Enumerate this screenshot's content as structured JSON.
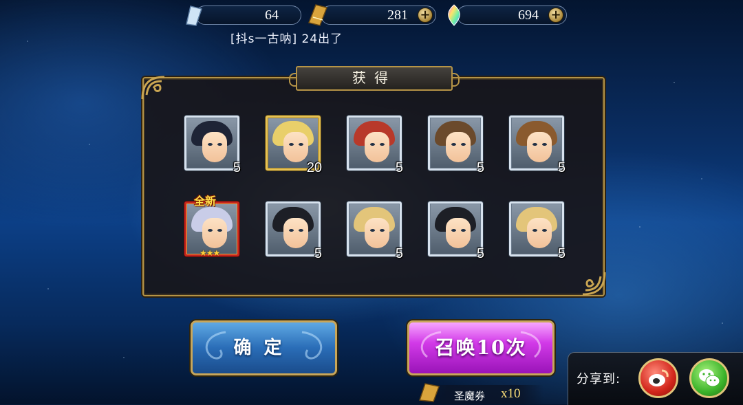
{
  "currencies": [
    {
      "name": "crystal",
      "value": "64",
      "has_plus": false,
      "icon": "crystal-icon"
    },
    {
      "name": "ticket",
      "value": "281",
      "has_plus": true,
      "icon": "gold-ticket-icon"
    },
    {
      "name": "gem",
      "value": "694",
      "has_plus": true,
      "icon": "rainbow-gem-icon"
    }
  ],
  "plus_symbol": "+",
  "ticker": "[抖s一古呐] 24出了",
  "panel": {
    "title": "获得"
  },
  "cards": [
    {
      "count": "5",
      "frame": "silver",
      "hair": "#1e2436",
      "new": false
    },
    {
      "count": "20",
      "frame": "gold",
      "hair": "#e9cf6a",
      "new": false
    },
    {
      "count": "5",
      "frame": "silver",
      "hair": "#b8392a",
      "new": false
    },
    {
      "count": "5",
      "frame": "silver",
      "hair": "#6b4a2c",
      "new": false
    },
    {
      "count": "5",
      "frame": "silver",
      "hair": "#8a5a2e",
      "new": false
    },
    {
      "count": "",
      "frame": "red",
      "hair": "#c9cde8",
      "new": true,
      "new_label": "全新",
      "stars": "★★★"
    },
    {
      "count": "5",
      "frame": "silver",
      "hair": "#1d1f26",
      "new": false
    },
    {
      "count": "5",
      "frame": "silver",
      "hair": "#e3c57a",
      "new": false
    },
    {
      "count": "5",
      "frame": "silver",
      "hair": "#1d1f26",
      "new": false
    },
    {
      "count": "5",
      "frame": "silver",
      "hair": "#e3c57a",
      "new": false
    }
  ],
  "buttons": {
    "confirm": "确定",
    "summon": "召唤10次"
  },
  "ticket": {
    "label": "圣魔券",
    "qty": "x10"
  },
  "share": {
    "label": "分享到:"
  },
  "colors": {
    "panel_border": "#b59447",
    "summon": "#d23ae8",
    "confirm": "#2a6db7",
    "weibo": "#d2261b",
    "wechat": "#3cb32a"
  }
}
